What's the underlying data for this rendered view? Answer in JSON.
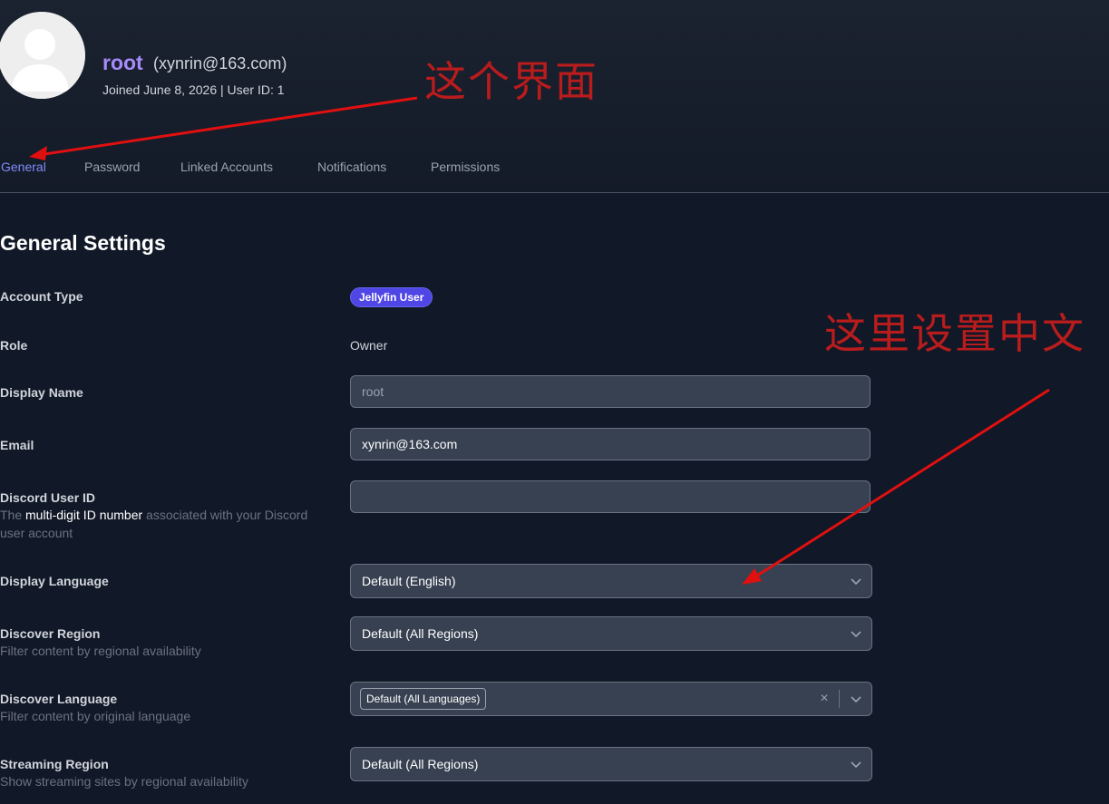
{
  "profile": {
    "name": "root",
    "email": "(xynrin@163.com)",
    "meta": "Joined June 8, 2026 | User ID: 1"
  },
  "tabs": [
    {
      "label": "General",
      "active": true
    },
    {
      "label": "Password",
      "active": false
    },
    {
      "label": "Linked Accounts",
      "active": false
    },
    {
      "label": "Notifications",
      "active": false
    },
    {
      "label": "Permissions",
      "active": false
    }
  ],
  "settings": {
    "title": "General Settings",
    "account_type": {
      "label": "Account Type",
      "badge": "Jellyfin User"
    },
    "role": {
      "label": "Role",
      "value": "Owner"
    },
    "display_name": {
      "label": "Display Name",
      "placeholder": "root"
    },
    "email": {
      "label": "Email",
      "value": "xynrin@163.com"
    },
    "discord": {
      "label": "Discord User ID",
      "desc_before": "The ",
      "desc_highlight": "multi-digit ID number",
      "desc_after": " associated with your Discord user account",
      "value": ""
    },
    "display_language": {
      "label": "Display Language",
      "value": "Default (English)"
    },
    "discover_region": {
      "label": "Discover Region",
      "desc": "Filter content by regional availability",
      "value": "Default (All Regions)"
    },
    "discover_language": {
      "label": "Discover Language",
      "desc": "Filter content by original language",
      "chip": "Default (All Languages)",
      "clear": "×"
    },
    "streaming_region": {
      "label": "Streaming Region",
      "desc": "Show streaming sites by regional availability",
      "value": "Default (All Regions)"
    }
  },
  "annotations": {
    "interface_note": "这个界面",
    "language_note": "这里设置中文",
    "color": "#cc1111"
  },
  "colors": {
    "accent": "#818cf8",
    "username": "#a78bfa",
    "badge": "#4f46e5",
    "background": "#111827"
  }
}
